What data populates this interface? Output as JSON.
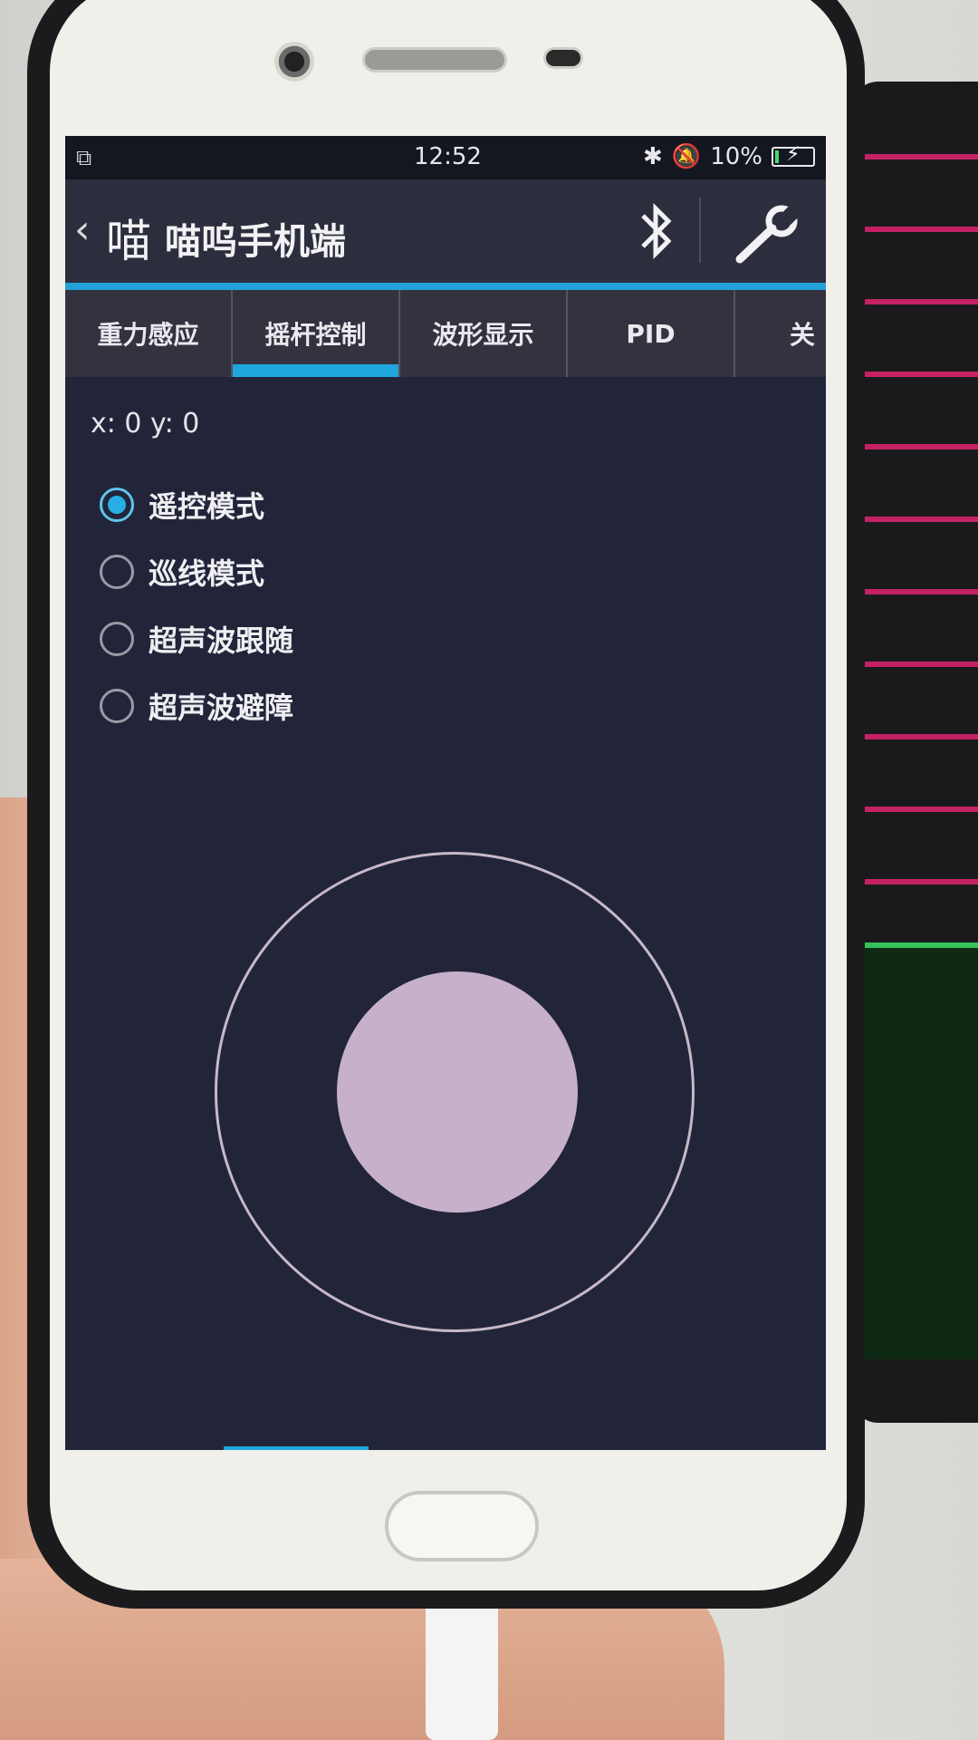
{
  "status_bar": {
    "time": "12:52",
    "battery_percent": "10%",
    "battery_level": 0.1,
    "icons": [
      "copy-icon",
      "bluetooth-icon",
      "mute-bell-icon",
      "charging-battery-icon"
    ]
  },
  "app_bar": {
    "back_glyph": "‹",
    "logo_text": "喵",
    "title": "喵呜手机端",
    "icons": [
      "bluetooth-icon",
      "wrench-icon"
    ]
  },
  "tabs": [
    {
      "label": "重力感应",
      "active": false
    },
    {
      "label": "摇杆控制",
      "active": true
    },
    {
      "label": "波形显示",
      "active": false
    },
    {
      "label": "PID",
      "active": false
    },
    {
      "label": "关",
      "active": false
    }
  ],
  "joystick": {
    "coords_label": "x: 0 y: 0"
  },
  "modes": [
    {
      "label": "遥控模式",
      "checked": true
    },
    {
      "label": "巡线模式",
      "checked": false
    },
    {
      "label": "超声波跟随",
      "checked": false
    },
    {
      "label": "超声波避障",
      "checked": false
    }
  ],
  "colors": {
    "accent": "#22a2d8",
    "screen_bg": "#22253a",
    "knob": "#c6b0ca"
  }
}
